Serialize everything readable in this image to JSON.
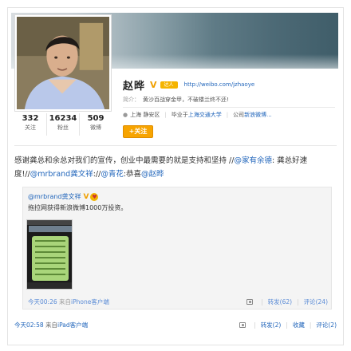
{
  "profile": {
    "name": "赵晔",
    "vip_label": "达人",
    "homepage": "http://weibo.com/jzhaoye",
    "bio_label": "简介：",
    "bio": "黄沙百战穿金甲，不破楼兰终不还!",
    "location": "上海 静安区",
    "edu_prefix": "毕业于",
    "school": "上海交通大学",
    "company_prefix": "公司",
    "company": "新浪微博...",
    "follow_label": "+关注",
    "stats": [
      {
        "num": "332",
        "label": "关注"
      },
      {
        "num": "16234",
        "label": "粉丝"
      },
      {
        "num": "509",
        "label": "微博"
      }
    ]
  },
  "post": {
    "text_start": "感谢龚总和余总对我们的宣传，创业中最需要的就是支持和坚持   //",
    "mention1": "@家有余德",
    "text_mid1": ": 龚总好速度!//",
    "mention2": "@mrbrand龚文祥",
    "text_mid2": "://",
    "mention3": "@青花",
    "text_mid3": ":恭喜",
    "mention4": "@赵晔",
    "time": "今天02:58",
    "source_prefix": "来自",
    "source": "iPad客户端",
    "repost": "转发(2)",
    "favorite": "收藏",
    "comment": "评论(2)"
  },
  "repost_box": {
    "author": "@mrbrand龚文祥",
    "text": "拖拉网获得新浪微博1000万投资。",
    "time": "今天00:26",
    "source_prefix": "来自",
    "source": "iPhone客户端",
    "repost": "转发(62)",
    "comment": "评论(24)"
  },
  "colors": {
    "link": "#2266bb",
    "accent": "#f7a400"
  }
}
